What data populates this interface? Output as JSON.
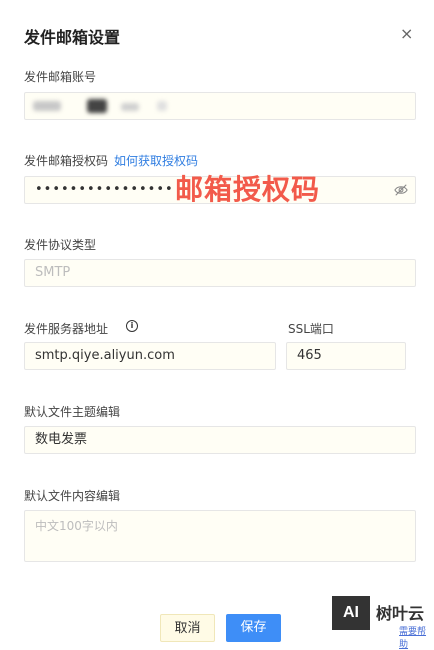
{
  "dialog": {
    "title": "发件邮箱设置",
    "close_glyph": "×"
  },
  "fields": {
    "account_label": "发件邮箱账号",
    "auth_label": "发件邮箱授权码",
    "auth_link": "如何获取授权码",
    "auth_value": "••••••••••••••••",
    "protocol_label": "发件协议类型",
    "protocol_placeholder": "SMTP",
    "server_label": "发件服务器地址",
    "server_value": "smtp.qiye.aliyun.com",
    "ssl_label": "SSL端口",
    "ssl_value": "465",
    "subject_label": "默认文件主题编辑",
    "subject_value": "数电发票",
    "content_label": "默认文件内容编辑",
    "content_placeholder": "中文100字以内"
  },
  "overlay_annotation": "邮箱授权码",
  "icons": {
    "info": "i",
    "password_toggle": "eye-off-icon"
  },
  "buttons": {
    "cancel": "取消",
    "save": "保存"
  },
  "watermark": {
    "logo": "AI",
    "brand": "树叶云",
    "sub": "需要帮助"
  },
  "colors": {
    "primary": "#3e8ef7",
    "link": "#2f7de1",
    "annotation": "#f25a4a",
    "field_bg": "#fffef5"
  }
}
